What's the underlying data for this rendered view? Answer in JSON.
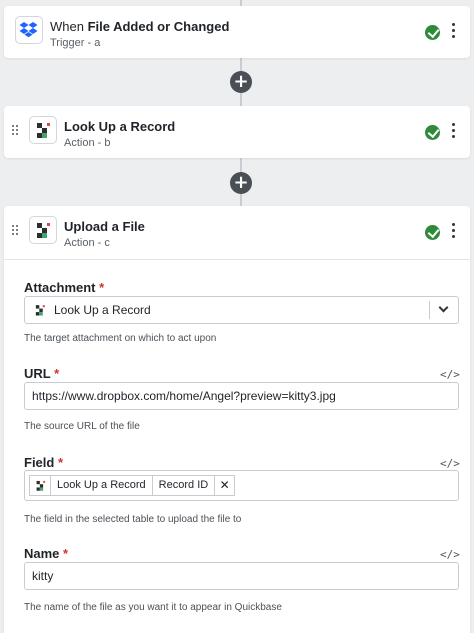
{
  "steps": [
    {
      "prefix": "When ",
      "title": "File Added or Changed",
      "subtitle": "Trigger - a",
      "icon": "dropbox-icon"
    },
    {
      "prefix": "",
      "title": "Look Up a Record",
      "subtitle": "Action - b",
      "icon": "quickbase-icon"
    },
    {
      "prefix": "",
      "title": "Upload a File",
      "subtitle": "Action - c",
      "icon": "quickbase-icon"
    }
  ],
  "add_step_label": "+",
  "form": {
    "attachment": {
      "label": "Attachment",
      "required_mark": "*",
      "value": "Look Up a Record",
      "help": "The target attachment on which to act upon"
    },
    "url": {
      "label": "URL",
      "required_mark": "*",
      "value": "https://www.dropbox.com/home/Angel?preview=kitty3.jpg",
      "help": "The source URL of the file",
      "code_toggle": "</>"
    },
    "field": {
      "label": "Field",
      "required_mark": "*",
      "chips": [
        "Look Up a Record",
        "Record ID"
      ],
      "remove": "✕",
      "help": "The field in the selected table to upload the file to",
      "code_toggle": "</>"
    },
    "name": {
      "label": "Name",
      "required_mark": "*",
      "value": "kitty",
      "help": "The name of the file as you want it to appear in Quickbase",
      "code_toggle": "</>"
    }
  },
  "colors": {
    "success": "#2f8a3a",
    "required": "#d0342c",
    "dropbox": "#1f62ff",
    "quickbase": "#2d2d2d"
  }
}
